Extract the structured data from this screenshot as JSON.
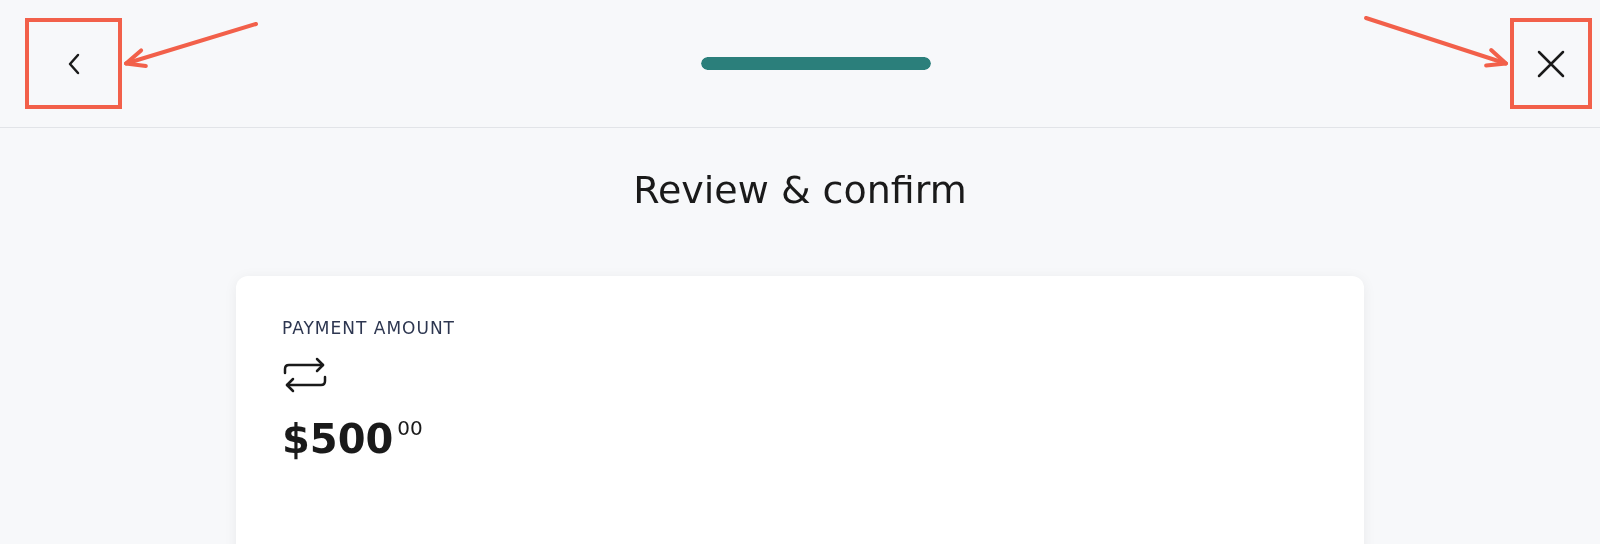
{
  "header": {
    "back_button": {
      "highlighted": true
    },
    "progress": {
      "level": 1
    },
    "close_button": {
      "highlighted": true
    }
  },
  "title": "Review & confirm",
  "card": {
    "label": "PAYMENT AMOUNT",
    "amount": "$500$^{00}$"
  }
}
